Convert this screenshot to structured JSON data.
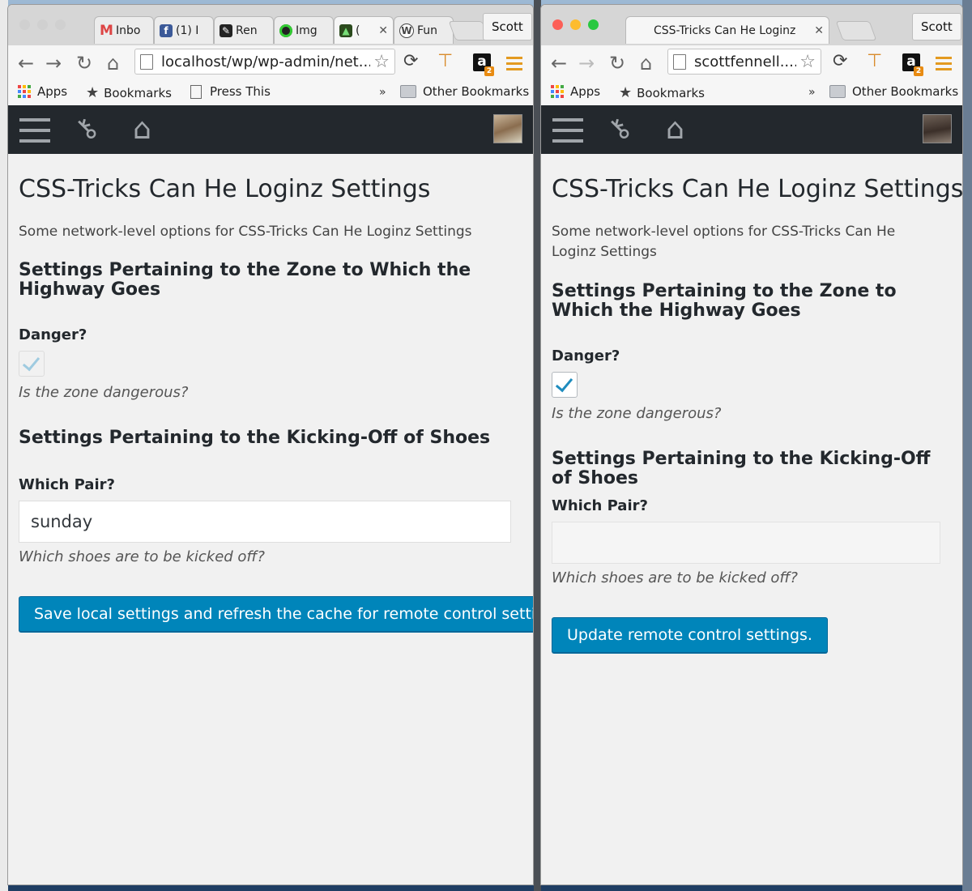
{
  "colors": {
    "wp_admin_bar": "#23282d",
    "wp_button": "#0085ba",
    "menu_accent": "#e39a20",
    "check_blue": "#1e8cbe"
  },
  "left": {
    "tabs": [
      {
        "label": "Inbo",
        "icon": "gmail-icon"
      },
      {
        "label": "(1) I",
        "icon": "facebook-icon"
      },
      {
        "label": "Ren",
        "icon": "pencil-icon"
      },
      {
        "label": "Img",
        "icon": "imgur-icon"
      },
      {
        "label": "(",
        "icon": "tab-favicon-icon"
      },
      {
        "label": "Fun",
        "icon": "wordpress-icon"
      }
    ],
    "profile": "Scott",
    "url": "localhost/wp/wp-admin/net...",
    "bookmarks": {
      "apps": "Apps",
      "bookmarks": "Bookmarks",
      "press_this": "Press This",
      "more": "»",
      "other": "Other Bookmarks"
    },
    "page": {
      "title": "CSS-Tricks Can He Loginz Settings",
      "intro": "Some network-level options for CSS-Tricks Can He Loginz Settings",
      "section1_title": "Settings Pertaining to the Zone to Which the Highway Goes",
      "danger_label": "Danger?",
      "danger_checked": true,
      "danger_desc": "Is the zone dangerous?",
      "section2_title": "Settings Pertaining to the Kicking-Off of Shoes",
      "pair_label": "Which Pair?",
      "pair_value": "sunday",
      "pair_desc": "Which shoes are to be kicked off?",
      "submit_label": "Save local settings and refresh the cache for remote control settings."
    }
  },
  "right": {
    "tab_title": "CSS-Tricks Can He Loginz",
    "profile": "Scott",
    "url": "scottfennell....",
    "bookmarks": {
      "apps": "Apps",
      "bookmarks": "Bookmarks",
      "more": "»",
      "other": "Other Bookmarks"
    },
    "page": {
      "title": "CSS-Tricks Can He Loginz Settings",
      "intro": "Some network-level options for CSS-Tricks Can He Loginz Settings",
      "section1_title": "Settings Pertaining to the Zone to Which the Highway Goes",
      "danger_label": "Danger?",
      "danger_checked": true,
      "danger_desc": "Is the zone dangerous?",
      "section2_title": "Settings Pertaining to the Kicking-Off of Shoes",
      "pair_label": "Which Pair?",
      "pair_value": "",
      "pair_desc": "Which shoes are to be kicked off?",
      "submit_label": "Update remote control settings."
    }
  }
}
